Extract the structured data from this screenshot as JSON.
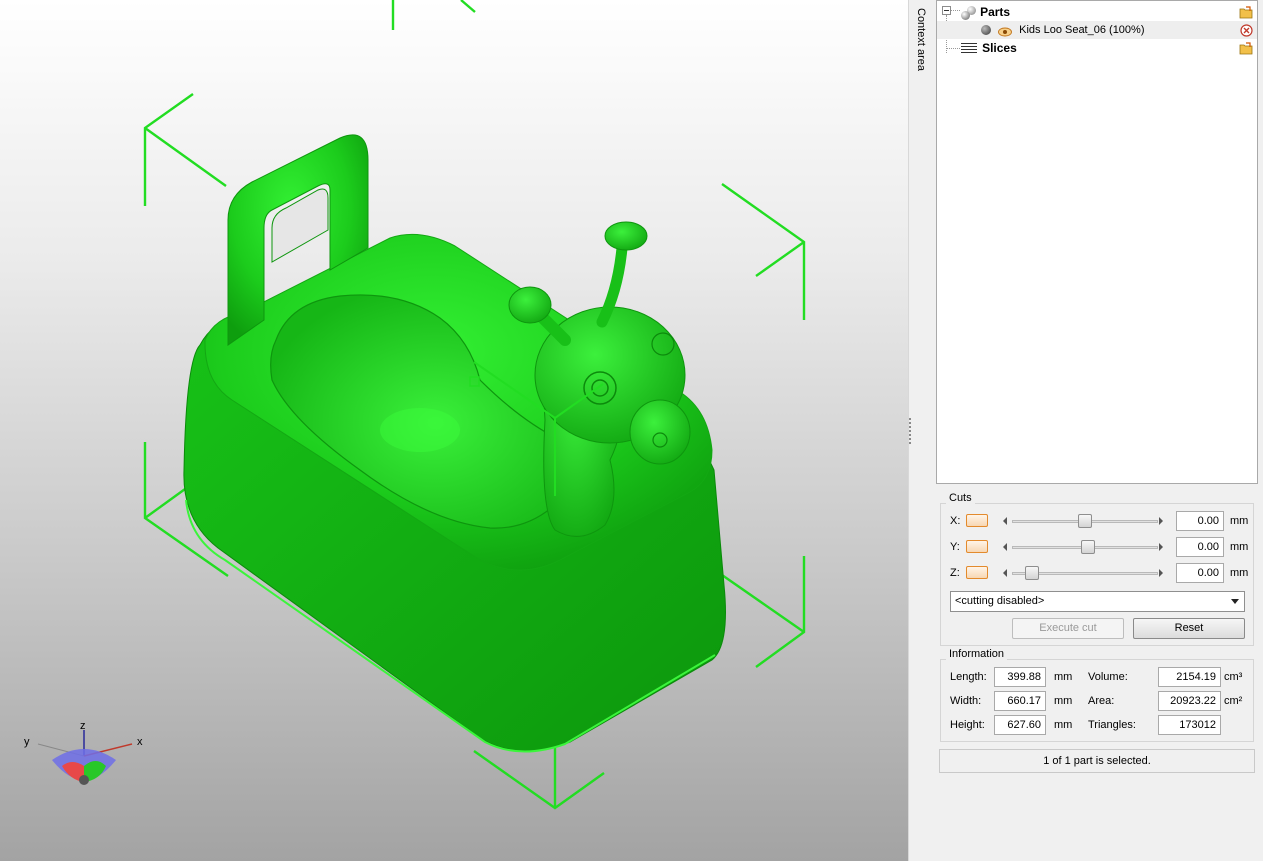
{
  "window": {
    "context_area_label": "Context area"
  },
  "viewport": {
    "model_color": "#1fd61f",
    "bbox_color": "#22dd22",
    "axis_labels": {
      "x": "x",
      "y": "y",
      "z": "z"
    }
  },
  "tree": {
    "parts_label": "Parts",
    "part_item": "Kids Loo Seat_06 (100%)",
    "slices_label": "Slices"
  },
  "cuts": {
    "title": "Cuts",
    "rows": [
      {
        "axis": "X:",
        "value": "0.00",
        "unit": "mm",
        "slider_pos": 0.5
      },
      {
        "axis": "Y:",
        "value": "0.00",
        "unit": "mm",
        "slider_pos": 0.52
      },
      {
        "axis": "Z:",
        "value": "0.00",
        "unit": "mm",
        "slider_pos": 0.1
      }
    ],
    "mode_select": "<cutting disabled>",
    "execute_label": "Execute cut",
    "reset_label": "Reset"
  },
  "information": {
    "title": "Information",
    "length_label": "Length:",
    "length_value": "399.88",
    "length_unit": "mm",
    "width_label": "Width:",
    "width_value": "660.17",
    "width_unit": "mm",
    "height_label": "Height:",
    "height_value": "627.60",
    "height_unit": "mm",
    "volume_label": "Volume:",
    "volume_value": "2154.19",
    "volume_unit": "cm³",
    "area_label": "Area:",
    "area_value": "20923.22",
    "area_unit": "cm²",
    "triangles_label": "Triangles:",
    "triangles_value": "173012"
  },
  "status": {
    "selection_text": "1 of 1 part is selected."
  },
  "colors": {
    "accent_orange": "#e38a2c",
    "panel_bg": "#f0f0f0",
    "remove_red": "#c0392b"
  }
}
